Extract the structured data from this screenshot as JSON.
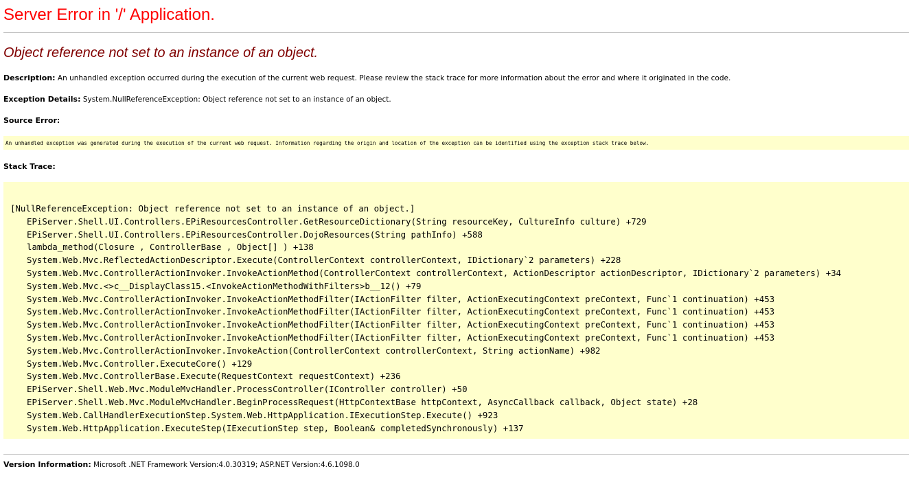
{
  "title": "Server Error in '/' Application.",
  "subtitle": "Object reference not set to an instance of an object.",
  "description": {
    "label": "Description:",
    "text": "An unhandled exception occurred during the execution of the current web request. Please review the stack trace for more information about the error and where it originated in the code."
  },
  "exception_details": {
    "label": "Exception Details:",
    "text": "System.NullReferenceException: Object reference not set to an instance of an object."
  },
  "source_error": {
    "label": "Source Error:",
    "text": "An unhandled exception was generated during the execution of the current web request. Information regarding the origin and location of the exception can be identified using the exception stack trace below."
  },
  "stack_trace": {
    "label": "Stack Trace:",
    "header": "[NullReferenceException: Object reference not set to an instance of an object.]",
    "frames": [
      "EPiServer.Shell.UI.Controllers.EPiResourcesController.GetResourceDictionary(String resourceKey, CultureInfo culture) +729",
      "EPiServer.Shell.UI.Controllers.EPiResourcesController.DojoResources(String pathInfo) +588",
      "lambda_method(Closure , ControllerBase , Object[] ) +138",
      "System.Web.Mvc.ReflectedActionDescriptor.Execute(ControllerContext controllerContext, IDictionary`2 parameters) +228",
      "System.Web.Mvc.ControllerActionInvoker.InvokeActionMethod(ControllerContext controllerContext, ActionDescriptor actionDescriptor, IDictionary`2 parameters) +34",
      "System.Web.Mvc.<>c__DisplayClass15.<InvokeActionMethodWithFilters>b__12() +79",
      "System.Web.Mvc.ControllerActionInvoker.InvokeActionMethodFilter(IActionFilter filter, ActionExecutingContext preContext, Func`1 continuation) +453",
      "System.Web.Mvc.ControllerActionInvoker.InvokeActionMethodFilter(IActionFilter filter, ActionExecutingContext preContext, Func`1 continuation) +453",
      "System.Web.Mvc.ControllerActionInvoker.InvokeActionMethodFilter(IActionFilter filter, ActionExecutingContext preContext, Func`1 continuation) +453",
      "System.Web.Mvc.ControllerActionInvoker.InvokeActionMethodFilter(IActionFilter filter, ActionExecutingContext preContext, Func`1 continuation) +453",
      "System.Web.Mvc.ControllerActionInvoker.InvokeAction(ControllerContext controllerContext, String actionName) +982",
      "System.Web.Mvc.Controller.ExecuteCore() +129",
      "System.Web.Mvc.ControllerBase.Execute(RequestContext requestContext) +236",
      "EPiServer.Shell.Web.Mvc.ModuleMvcHandler.ProcessController(IController controller) +50",
      "EPiServer.Shell.Web.Mvc.ModuleMvcHandler.BeginProcessRequest(HttpContextBase httpContext, AsyncCallback callback, Object state) +28",
      "System.Web.CallHandlerExecutionStep.System.Web.HttpApplication.IExecutionStep.Execute() +923",
      "System.Web.HttpApplication.ExecuteStep(IExecutionStep step, Boolean& completedSynchronously) +137"
    ]
  },
  "version_information": {
    "label": "Version Information:",
    "text": "Microsoft .NET Framework Version:4.0.30319; ASP.NET Version:4.6.1098.0"
  },
  "colors": {
    "title": "#ff0000",
    "subtitle": "#800000",
    "code_background": "#ffffcc",
    "rule": "#c0c0c0"
  }
}
